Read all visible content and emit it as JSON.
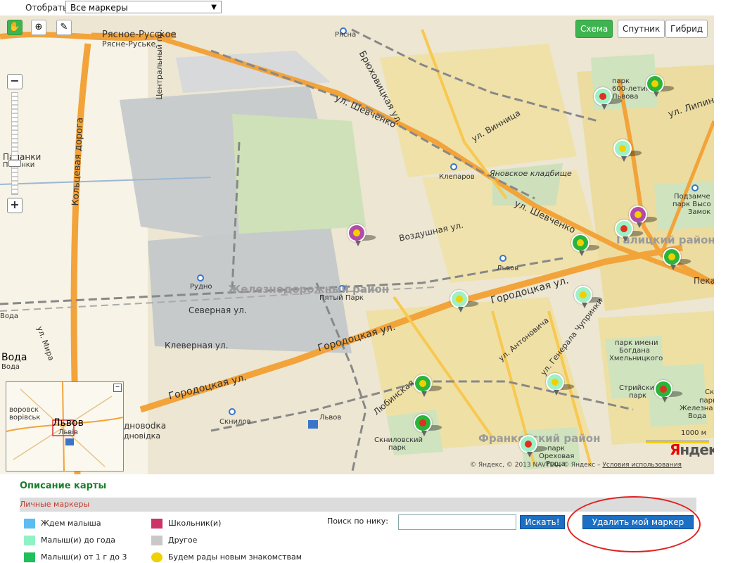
{
  "filter": {
    "label": "Отобрать:",
    "selected": "Все маркеры",
    "arrow": "▼"
  },
  "map_types": {
    "scheme": "Схема",
    "satellite": "Спутник",
    "hybrid": "Гибрид"
  },
  "map_labels": {
    "ryasne": "Рясное-Русское",
    "ryasne_ua": "Рясне-Руське",
    "ryasna_station": "Рясна",
    "bryukhovicka": "Брюховицкая ул.",
    "central": "Центральный пр.",
    "shevchenko_top": "ул. Шевченко",
    "vinnitsa": "ул. Винница",
    "palanki": "Паланки",
    "palanki_ua": "Паланки",
    "ring_road": "Кольцевая дорога",
    "klepariv": "Клепаров",
    "yanovske": "Яновское кладбище",
    "shevchenko_mid": "ул. Шевченко",
    "vozdushnaya": "Воздушная ул.",
    "park_600": "парк",
    "park_600_b": "600-летия",
    "park_600_c": "Львова",
    "lipinsk": "ул. Липинс",
    "high_castle_a": "Подзамче",
    "high_castle_b": "парк Высо",
    "high_castle_c": "Замок",
    "galicia": "Галицкий район",
    "lviv_station": "Львов",
    "rudno": "Рудно",
    "zheleznodorozhny": "Железнодорожный район",
    "pyaty_park": "Пятый Парк",
    "gorodotska_right": "Городоцкая ул.",
    "severnaya": "Северная ул.",
    "voda_top": "Вода",
    "mira": "ул. Мира",
    "klevernaya": "Клеверная ул.",
    "gorodotska_mid": "Городоцкая ул.",
    "antonovicha": "ул. Антоновича",
    "chuprinki": "ул. Генерала Чупринки",
    "pekar": "Пека",
    "voda_big": "Вода",
    "voda_small": "Вода",
    "gorodotska_left": "Городоцкая ул.",
    "khmelnitsky_a": "парк имени",
    "khmelnitsky_b": "Богдана",
    "khmelnitsky_c": "Хмельницкого",
    "lyubinska": "Любинская",
    "striysky_a": "Стрийский",
    "striysky_b": "парк",
    "zheleznaya_a": "Ск",
    "zheleznaya_b": "парк",
    "zheleznaya_c": "Железна",
    "zheleznaya_d": "Вода",
    "skniliv_station": "Скнилов",
    "lviv_airport": "Львов",
    "skniliv_park_a": "Скниловский",
    "skniliv_park_b": "парк",
    "frankivsky": "Франковский район",
    "orekh_a": "парк",
    "orekh_b": "Ореховая",
    "orekh_c": "Роща",
    "odnovodka": "дновodка",
    "odnovodka_ua": "дновідка",
    "scale": "1000 м"
  },
  "minimap": {
    "vorovsk": "воровск",
    "vorovsk_ua": "ворівськ",
    "city": "Львов",
    "city_ua": "Львів"
  },
  "copyright": {
    "text": "© Яндекс, © 2013 NAVTEQ, © Яндекс – ",
    "link": "Условия использования"
  },
  "brand": {
    "first": "Я",
    "rest": "ндекс"
  },
  "description": {
    "title": "Описание карты",
    "section": "Личные маркеры",
    "legend": [
      {
        "label": "Ждем малыша",
        "color": "#5bbcf0"
      },
      {
        "label": "Малыш(и) до года",
        "color": "#8ff2c4"
      },
      {
        "label": "Малыш(и) от 1 г до 3",
        "color": "#1fbf5a"
      },
      {
        "label": "Школьник(и)",
        "color": "#cc3366"
      },
      {
        "label": "Другое",
        "color": "#c8c8c8"
      },
      {
        "label": "Будем рады новым знакомствам",
        "color": "#f0d000"
      }
    ]
  },
  "search": {
    "label": "Поиск по нику:",
    "value": "",
    "find_button": "Искать!",
    "delete_button": "Удалить мой маркер"
  }
}
